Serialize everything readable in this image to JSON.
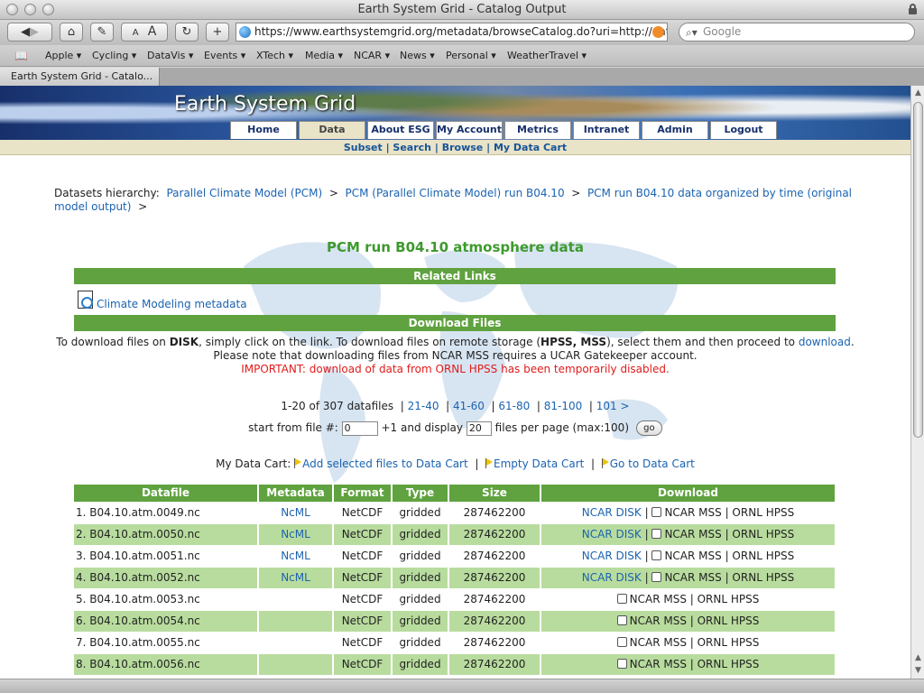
{
  "window": {
    "title": "Earth System Grid - Catalog Output"
  },
  "toolbar": {
    "font_small": "A",
    "font_large": "A",
    "url": "https://www.earthsystemgrid.org/metadata/browseCatalog.do?uri=http://data",
    "search_placeholder": "Google"
  },
  "bookmarks": [
    {
      "label": "Apple ▾"
    },
    {
      "label": "Cycling ▾"
    },
    {
      "label": "DataVis ▾"
    },
    {
      "label": "Events ▾"
    },
    {
      "label": "XTech ▾"
    },
    {
      "label": "Media ▾"
    },
    {
      "label": "NCAR ▾"
    },
    {
      "label": "News ▾"
    },
    {
      "label": "Personal ▾"
    },
    {
      "label": "WeatherTravel ▾"
    }
  ],
  "tab": {
    "label": "Earth System Grid - Catalo..."
  },
  "site": {
    "title": "Earth System Grid",
    "nav": [
      {
        "label": "Home"
      },
      {
        "label": "Data"
      },
      {
        "label": "About ESG"
      },
      {
        "label": "My Account"
      },
      {
        "label": "Metrics"
      },
      {
        "label": "Intranet"
      },
      {
        "label": "Admin"
      },
      {
        "label": "Logout"
      }
    ],
    "subnav": [
      {
        "label": "Subset"
      },
      {
        "label": "Search"
      },
      {
        "label": "Browse"
      },
      {
        "label": "My Data Cart"
      }
    ]
  },
  "breadcrumb": {
    "prefix": "Datasets hierarchy:",
    "items": [
      "Parallel Climate Model (PCM)",
      "PCM (Parallel Climate Model) run B04.10",
      "PCM run B04.10 data organized by time (original model output)"
    ],
    "sep": ">"
  },
  "page_title": "PCM run B04.10 atmosphere data",
  "related_links": {
    "header": "Related Links",
    "metadata_link": "Climate Modeling metadata"
  },
  "download": {
    "header": "Download Files",
    "line1_a": "To download files on ",
    "line1_disk": "DISK",
    "line1_b": ", simply click on the link. To download files on remote storage (",
    "line1_hpss": "HPSS, MSS",
    "line1_c": "), select them and then proceed to ",
    "line1_link": "download",
    "line1_d": ".",
    "line2": "Please note that downloading files from NCAR MSS requires a UCAR Gatekeeper account.",
    "line3_label": "IMPORTANT",
    "line3_text": ": download of data from ORNL HPSS has been temporarily disabled."
  },
  "pagination": {
    "summary": "1-20 of 307 datafiles",
    "pages": [
      "21-40",
      "41-60",
      "61-80",
      "81-100",
      "101 >"
    ],
    "start_label": "start from file #:",
    "start_value": "0",
    "mid_label": "+1 and display",
    "per_page_value": "20",
    "end_label": "files per page (max:100)",
    "go": "go"
  },
  "cart": {
    "label": "My Data Cart:",
    "add": "Add selected files to Data Cart",
    "empty": "Empty Data Cart",
    "go": "Go to Data Cart"
  },
  "table": {
    "columns": [
      "Datafile",
      "Metadata",
      "Format",
      "Type",
      "Size",
      "Download"
    ],
    "rows": [
      {
        "name": "1. B04.10.atm.0049.nc",
        "meta": "NcML",
        "format": "NetCDF",
        "type": "gridded",
        "size": "287462200",
        "disk": "NCAR DISK",
        "mss": "NCAR MSS | ORNL HPSS"
      },
      {
        "name": "2. B04.10.atm.0050.nc",
        "meta": "NcML",
        "format": "NetCDF",
        "type": "gridded",
        "size": "287462200",
        "disk": "NCAR DISK",
        "mss": "NCAR MSS | ORNL HPSS"
      },
      {
        "name": "3. B04.10.atm.0051.nc",
        "meta": "NcML",
        "format": "NetCDF",
        "type": "gridded",
        "size": "287462200",
        "disk": "NCAR DISK",
        "mss": "NCAR MSS | ORNL HPSS"
      },
      {
        "name": "4. B04.10.atm.0052.nc",
        "meta": "NcML",
        "format": "NetCDF",
        "type": "gridded",
        "size": "287462200",
        "disk": "NCAR DISK",
        "mss": "NCAR MSS | ORNL HPSS"
      },
      {
        "name": "5. B04.10.atm.0053.nc",
        "meta": "",
        "format": "NetCDF",
        "type": "gridded",
        "size": "287462200",
        "disk": "",
        "mss": "NCAR MSS | ORNL HPSS"
      },
      {
        "name": "6. B04.10.atm.0054.nc",
        "meta": "",
        "format": "NetCDF",
        "type": "gridded",
        "size": "287462200",
        "disk": "",
        "mss": "NCAR MSS | ORNL HPSS"
      },
      {
        "name": "7. B04.10.atm.0055.nc",
        "meta": "",
        "format": "NetCDF",
        "type": "gridded",
        "size": "287462200",
        "disk": "",
        "mss": "NCAR MSS | ORNL HPSS"
      },
      {
        "name": "8. B04.10.atm.0056.nc",
        "meta": "",
        "format": "NetCDF",
        "type": "gridded",
        "size": "287462200",
        "disk": "",
        "mss": "NCAR MSS | ORNL HPSS"
      }
    ]
  },
  "colors": {
    "green_bar": "#5fa23f",
    "row_alt": "#b8dc9e",
    "title_green": "#3e9a2e",
    "link_blue": "#1b63b0",
    "warning_red": "#e01b1b"
  }
}
